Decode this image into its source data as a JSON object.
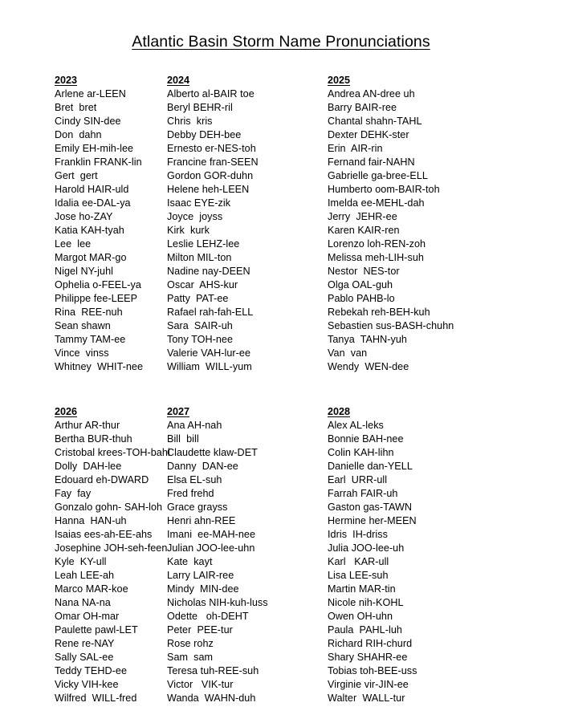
{
  "document": {
    "title": "Atlantic Basin Storm Name Pronunciations"
  },
  "columns": [
    {
      "year": "2023",
      "names": [
        "Arlene ar-LEEN",
        "Bret  bret",
        "Cindy SIN-dee",
        "Don  dahn",
        "Emily EH-mih-lee",
        "Franklin FRANK-lin",
        "Gert  gert",
        "Harold HAIR-uld",
        "Idalia ee-DAL-ya",
        "Jose ho-ZAY",
        "Katia KAH-tyah",
        "Lee  lee",
        "Margot MAR-go",
        "Nigel NY-juhl",
        "Ophelia o-FEEL-ya",
        "Philippe fee-LEEP",
        "Rina  REE-nuh",
        "Sean shawn",
        "Tammy TAM-ee",
        "Vince  vinss",
        "Whitney  WHIT-nee"
      ]
    },
    {
      "year": "2024",
      "names": [
        "Alberto al-BAIR toe",
        "Beryl BEHR-ril",
        "Chris  kris",
        "Debby DEH-bee",
        "Ernesto er-NES-toh",
        "Francine fran-SEEN",
        "Gordon GOR-duhn",
        "Helene heh-LEEN",
        "Isaac EYE-zik",
        "Joyce  joyss",
        "Kirk  kurk",
        "Leslie LEHZ-lee",
        "Milton MIL-ton",
        "Nadine nay-DEEN",
        "Oscar  AHS-kur",
        "Patty  PAT-ee",
        "Rafael rah-fah-ELL",
        "Sara  SAIR-uh",
        "Tony TOH-nee",
        "Valerie VAH-lur-ee",
        "William  WILL-yum"
      ]
    },
    {
      "year": "2025",
      "names": [
        "Andrea AN-dree uh",
        "Barry BAIR-ree",
        "Chantal shahn-TAHL",
        "Dexter DEHK-ster",
        "Erin  AIR-rin",
        "Fernand fair-NAHN",
        "Gabrielle ga-bree-ELL",
        "Humberto oom-BAIR-toh",
        "Imelda ee-MEHL-dah",
        "Jerry  JEHR-ee",
        "Karen KAIR-ren",
        "Lorenzo loh-REN-zoh",
        "Melissa meh-LIH-suh",
        "Nestor  NES-tor",
        "Olga OAL-guh",
        "Pablo PAHB-lo",
        "Rebekah reh-BEH-kuh",
        "Sebastien sus-BASH-chuhn",
        "Tanya  TAHN-yuh",
        "Van  van",
        "Wendy  WEN-dee"
      ]
    },
    {
      "year": "2026",
      "names": [
        "Arthur AR-thur",
        "Bertha BUR-thuh",
        "Cristobal krees-TOH-bahl",
        "Dolly  DAH-lee",
        "Edouard eh-DWARD",
        "Fay  fay",
        "Gonzalo gohn- SAH-loh",
        "Hanna  HAN-uh",
        "Isaias ees-ah-EE-ahs",
        "Josephine JOH-seh-feen",
        "Kyle  KY-ull",
        "Leah LEE-ah",
        "Marco MAR-koe",
        "Nana NA-na",
        "Omar OH-mar",
        "Paulette pawl-LET",
        "Rene re-NAY",
        "Sally SAL-ee",
        "Teddy TEHD-ee",
        "Vicky VIH-kee",
        "Wilfred  WILL-fred"
      ]
    },
    {
      "year": "2027",
      "names": [
        "Ana AH-nah",
        "Bill  bill",
        "Claudette klaw-DET",
        "Danny  DAN-ee",
        "Elsa EL-suh",
        "Fred frehd",
        "Grace grayss",
        "Henri ahn-REE",
        "Imani  ee-MAH-nee",
        "Julian JOO-lee-uhn",
        "Kate  kayt",
        "Larry LAIR-ree",
        "Mindy  MIN-dee",
        "Nicholas NIH-kuh-luss",
        "Odette   oh-DEHT",
        "Peter  PEE-tur",
        "Rose rohz",
        "Sam  sam",
        "Teresa tuh-REE-suh",
        "Victor   VIK-tur",
        "Wanda  WAHN-duh"
      ]
    },
    {
      "year": "2028",
      "names": [
        "Alex AL-leks",
        "Bonnie BAH-nee",
        "Colin KAH-lihn",
        "Danielle dan-YELL",
        "Earl  URR-ull",
        "Farrah FAIR-uh",
        "Gaston gas-TAWN",
        "Hermine her-MEEN",
        "Idris  IH-driss",
        "Julia JOO-lee-uh",
        "Karl   KAR-ull",
        "Lisa LEE-suh",
        "Martin MAR-tin",
        "Nicole nih-KOHL",
        "Owen OH-uhn",
        "Paula  PAHL-luh",
        "Richard RIH-churd",
        "Shary SHAHR-ee",
        "Tobias toh-BEE-uss",
        "Virginie vir-JIN-ee",
        "Walter  WALL-tur"
      ]
    }
  ]
}
